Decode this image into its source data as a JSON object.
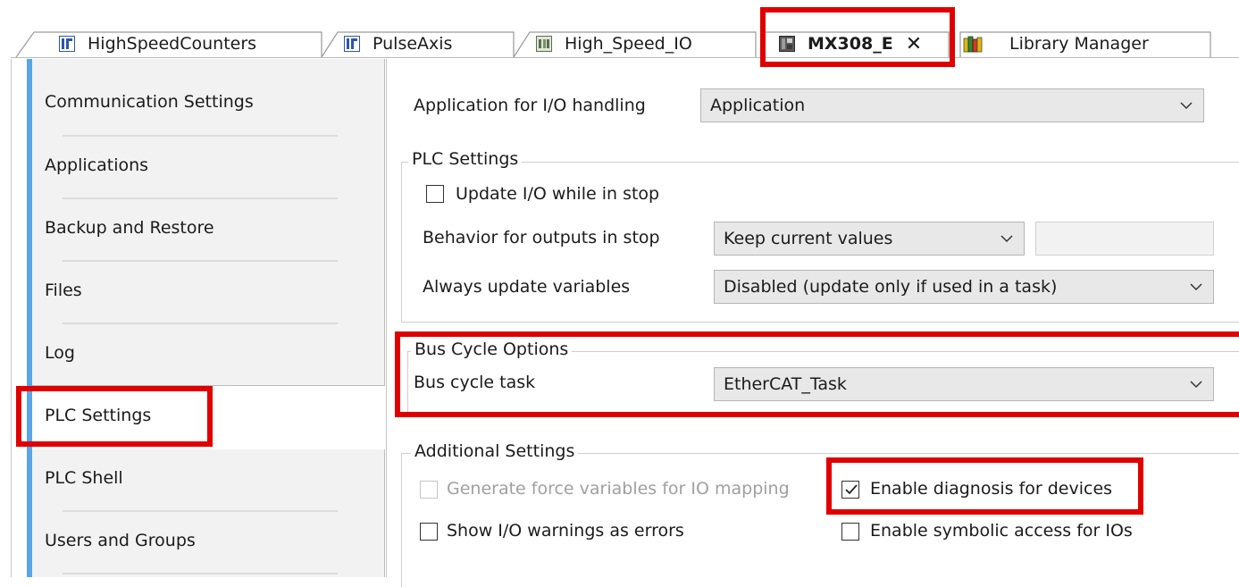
{
  "tabs": [
    {
      "label": "HighSpeedCounters",
      "icon": "function-block-icon"
    },
    {
      "label": "PulseAxis",
      "icon": "function-block-icon"
    },
    {
      "label": "High_Speed_IO",
      "icon": "io-module-icon"
    },
    {
      "label": "MX308_E",
      "icon": "device-icon",
      "active": true
    },
    {
      "label": "Library Manager",
      "icon": "library-icon"
    }
  ],
  "nav": {
    "items": [
      "Communication Settings",
      "Applications",
      "Backup and Restore",
      "Files",
      "Log",
      "PLC Settings",
      "PLC Shell",
      "Users and Groups"
    ],
    "selected": "PLC Settings"
  },
  "io_app": {
    "label": "Application for I/O handling",
    "value": "Application"
  },
  "plc_settings": {
    "title": "PLC Settings",
    "update_io_label": "Update I/O while in stop",
    "update_io_checked": false,
    "behavior_label": "Behavior for outputs in stop",
    "behavior_value": "Keep current values",
    "always_update_label": "Always update variables",
    "always_update_value": "Disabled (update only if used in a task)"
  },
  "bus_cycle": {
    "title": "Bus Cycle Options",
    "task_label": "Bus cycle task",
    "task_value": "EtherCAT_Task"
  },
  "additional": {
    "title": "Additional Settings",
    "force_vars_label": "Generate force variables for IO mapping",
    "force_vars_checked": false,
    "force_vars_disabled": true,
    "enable_diag_label": "Enable diagnosis for devices",
    "enable_diag_checked": true,
    "show_warnings_label": "Show I/O warnings as errors",
    "show_warnings_checked": false,
    "symbolic_access_label": "Enable symbolic access for IOs",
    "symbolic_access_checked": false
  },
  "colors": {
    "highlight": "#e00000",
    "nav_accent": "#5aa5e6",
    "combo_bg": "#e8e8e8"
  }
}
